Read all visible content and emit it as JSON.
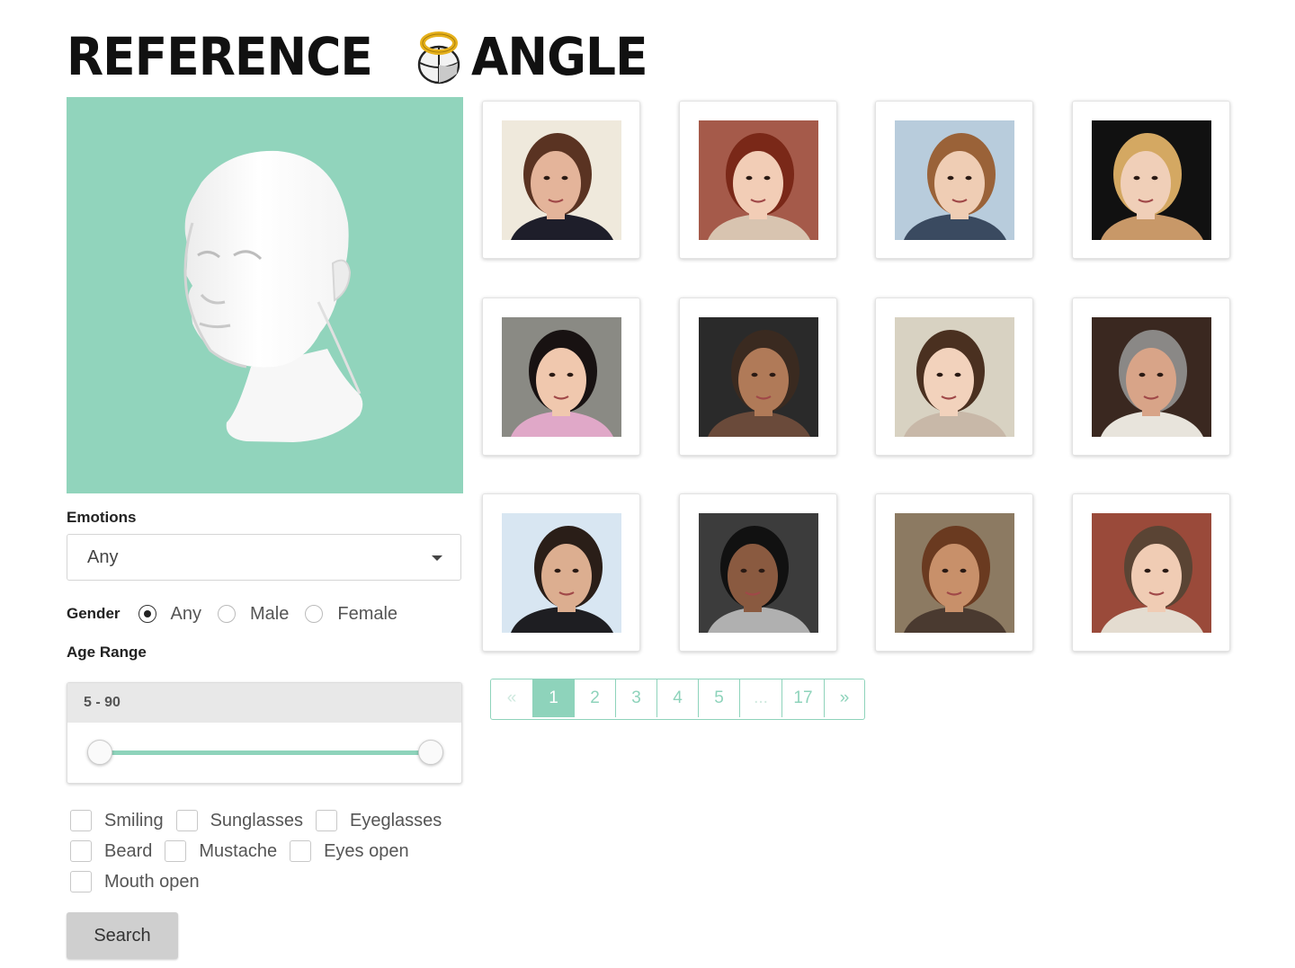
{
  "brand": {
    "word1": "REFERENCE",
    "word2": "ANGLE",
    "accent": "#8ed3bb"
  },
  "viewer": {
    "background": "#91d4bc",
    "model": "3d-head-model"
  },
  "filters": {
    "emotions": {
      "label": "Emotions",
      "value": "Any"
    },
    "gender": {
      "label": "Gender",
      "options": [
        "Any",
        "Male",
        "Female"
      ],
      "selected": "Any"
    },
    "age_range": {
      "label": "Age Range",
      "value_text": "5 - 90",
      "min": 5,
      "max": 90
    },
    "attributes": [
      [
        "Smiling",
        "Sunglasses",
        "Eyeglasses"
      ],
      [
        "Beard",
        "Mustache",
        "Eyes open"
      ],
      [
        "Mouth open"
      ]
    ],
    "search_label": "Search"
  },
  "results": {
    "faces": [
      {
        "bg": "#efe9dc",
        "hair": "#5a3322",
        "skin": "#e4b49a",
        "shirt": "#1e1e2a"
      },
      {
        "bg": "#a55a4a",
        "hair": "#7a2818",
        "skin": "#f2cdb6",
        "shirt": "#d8c4b0"
      },
      {
        "bg": "#b8ccdc",
        "hair": "#9a6238",
        "skin": "#efcdb4",
        "shirt": "#3a4a60"
      },
      {
        "bg": "#111111",
        "hair": "#d4a862",
        "skin": "#f0cfb8",
        "shirt": "#c89868"
      },
      {
        "bg": "#8a8a84",
        "hair": "#181212",
        "skin": "#f0c8ae",
        "shirt": "#e0a8c8"
      },
      {
        "bg": "#2a2a2a",
        "hair": "#3a2a20",
        "skin": "#b07a58",
        "shirt": "#6a4a3a"
      },
      {
        "bg": "#d8d2c2",
        "hair": "#4a3020",
        "skin": "#f2d2bc",
        "shirt": "#c8b8a8"
      },
      {
        "bg": "#3a2820",
        "hair": "#8a8886",
        "skin": "#d8a488",
        "shirt": "#e8e4dc"
      },
      {
        "bg": "#d8e6f2",
        "hair": "#2a1e18",
        "skin": "#dcae90",
        "shirt": "#1e1e22"
      },
      {
        "bg": "#3c3c3c",
        "hair": "#111111",
        "skin": "#8a5a40",
        "shirt": "#b0b0b0"
      },
      {
        "bg": "#8c7a62",
        "hair": "#6a3a20",
        "skin": "#c8906a",
        "shirt": "#4a3a30"
      },
      {
        "bg": "#9a4a3a",
        "hair": "#5a4434",
        "skin": "#f0ccb4",
        "shirt": "#e4dcd0"
      }
    ]
  },
  "pagination": {
    "items": [
      "«",
      "1",
      "2",
      "3",
      "4",
      "5",
      "...",
      "17",
      "»"
    ],
    "active": "1"
  }
}
